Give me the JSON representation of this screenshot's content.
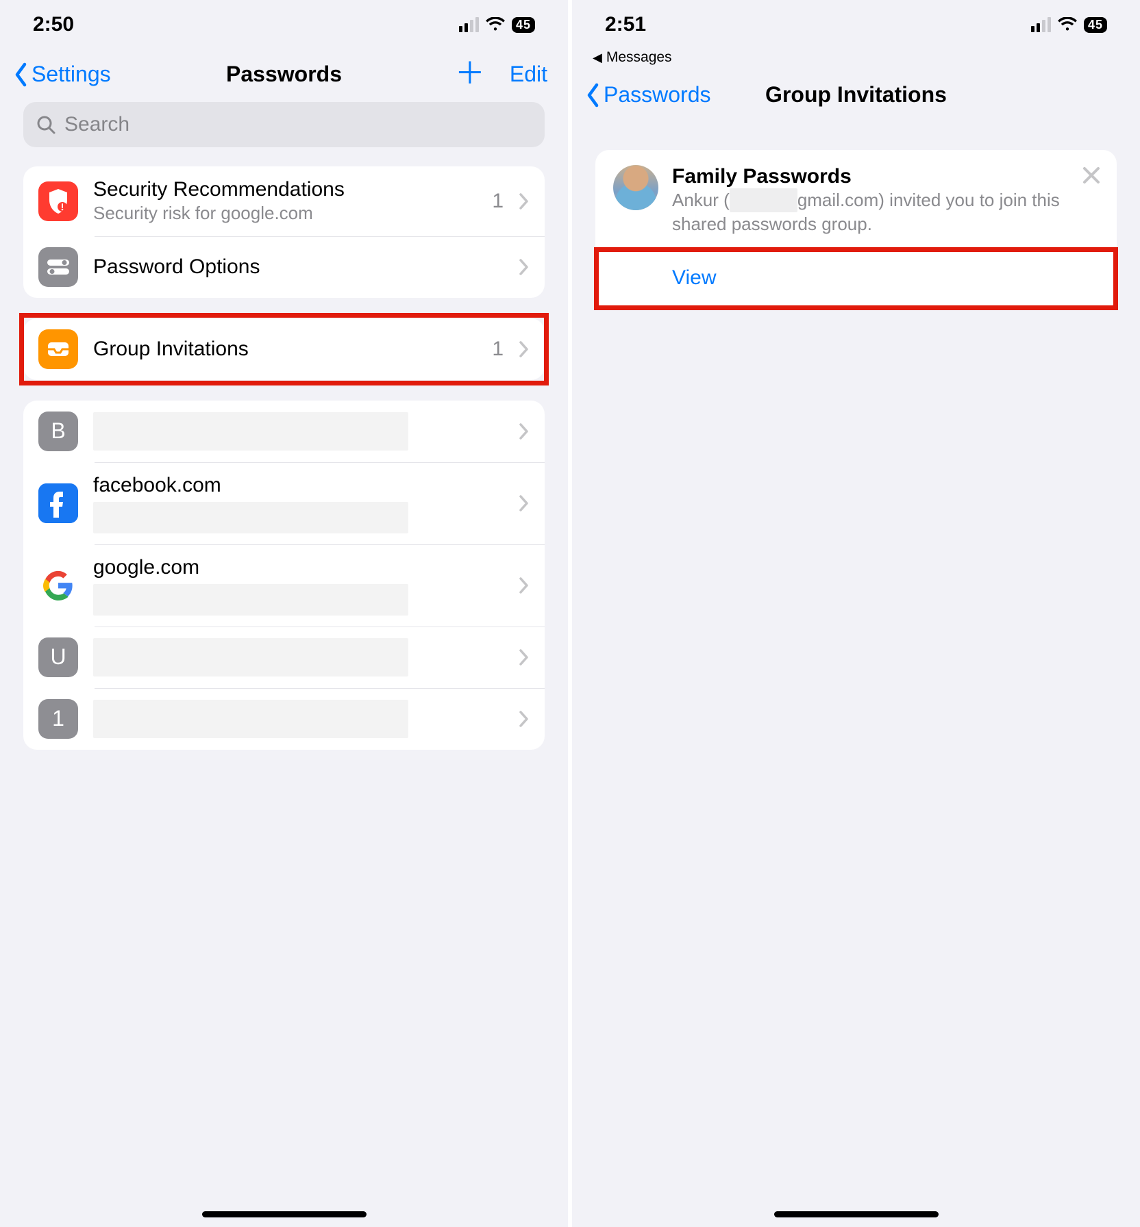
{
  "left": {
    "status": {
      "time": "2:50",
      "battery": "45"
    },
    "nav": {
      "back": "Settings",
      "title": "Passwords",
      "edit": "Edit"
    },
    "search": {
      "placeholder": "Search"
    },
    "section1": {
      "security": {
        "title": "Security Recommendations",
        "subtitle": "Security risk for google.com",
        "count": "1"
      },
      "options": {
        "title": "Password Options"
      }
    },
    "section2": {
      "invites": {
        "title": "Group Invitations",
        "count": "1"
      }
    },
    "accounts": [
      {
        "badge": "B",
        "title": "",
        "kind": "gray"
      },
      {
        "badge": "f",
        "title": "facebook.com",
        "kind": "fb"
      },
      {
        "badge": "G",
        "title": "google.com",
        "kind": "google"
      },
      {
        "badge": "U",
        "title": "",
        "kind": "gray"
      },
      {
        "badge": "1",
        "title": "",
        "kind": "gray"
      }
    ]
  },
  "right": {
    "status": {
      "time": "2:51",
      "battery": "45"
    },
    "breadcrumb": "Messages",
    "nav": {
      "back": "Passwords",
      "title": "Group Invitations"
    },
    "invite": {
      "title": "Family Passwords",
      "sub_prefix": "Ankur (",
      "sub_email_hidden": "xxxxxxx",
      "sub_email_suffix": "gmail.com",
      "sub_after": ") invited you to join this shared passwords group.",
      "view": "View"
    }
  }
}
